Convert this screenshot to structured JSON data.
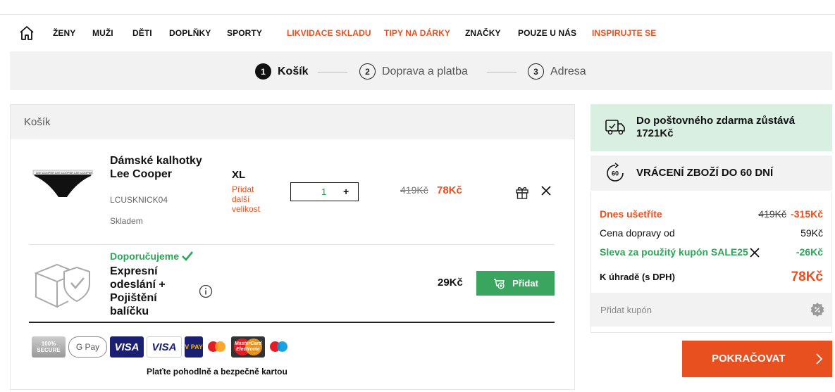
{
  "nav": {
    "items": [
      {
        "label": "ŽENY",
        "highlight": false
      },
      {
        "label": "MUŽI",
        "highlight": false
      },
      {
        "label": "DĚTI",
        "highlight": false
      },
      {
        "label": "DOPLŇKY",
        "highlight": false
      },
      {
        "label": "SPORTY",
        "highlight": false
      },
      {
        "label": "LIKVIDACE SKLADU",
        "highlight": true
      },
      {
        "label": "TIPY NA DÁRKY",
        "highlight": true
      },
      {
        "label": "ZNAČKY",
        "highlight": false
      },
      {
        "label": "POUZE U NÁS",
        "highlight": false
      },
      {
        "label": "INSPIRUJTE SE",
        "highlight": true
      }
    ]
  },
  "steps": [
    {
      "num": "1",
      "label": "Košík",
      "active": true
    },
    {
      "num": "2",
      "label": "Doprava a platba",
      "active": false
    },
    {
      "num": "3",
      "label": "Adresa",
      "active": false
    }
  ],
  "cart": {
    "title": "Košík",
    "product": {
      "name": "Dámské kalhotky Lee Cooper",
      "sku": "LCUSKNICK04",
      "stock": "Skladem",
      "size": "XL",
      "add_size": "Přidat další velikost",
      "qty": "1",
      "qty_plus": "+",
      "price_old": "419Kč",
      "price_new": "78Kč"
    },
    "recommend": {
      "label": "Doporučujeme",
      "name": "Expresní odeslání + Pojištění balíčku",
      "price": "29Kč",
      "button": "Přidat"
    },
    "payment_logos": [
      "100% SECURE",
      "G Pay",
      "VISA",
      "VISA",
      "V PAY",
      "maestro",
      "MasterCard Electronic",
      "maestro"
    ],
    "secure_text": "Plaťte pohodlně a bezpečně kartou"
  },
  "sidebar": {
    "free_shipping": "Do poštovného zdarma zůstává 1721Kč",
    "returns": "VRÁCENÍ ZBOŽÍ DO 60 DNÍ",
    "returns_icon_text": "60",
    "save_label": "Dnes ušetříte",
    "save_old": "419Kč",
    "save_value": "-315Kč",
    "shipping_label": "Cena dopravy od",
    "shipping_value": "59Kč",
    "coupon_label": "Sleva za použitý kupón SALE25",
    "coupon_value": "-26Kč",
    "total_label": "K úhradě (s DPH)",
    "total_value": "78Kč",
    "coupon_placeholder": "Přidat kupón",
    "continue": "POKRAČOVAT"
  },
  "colors": {
    "accent": "#e8501f",
    "green": "#3aa55e",
    "panel": "#f2f2f2",
    "ship_bg": "#d9efe2"
  }
}
